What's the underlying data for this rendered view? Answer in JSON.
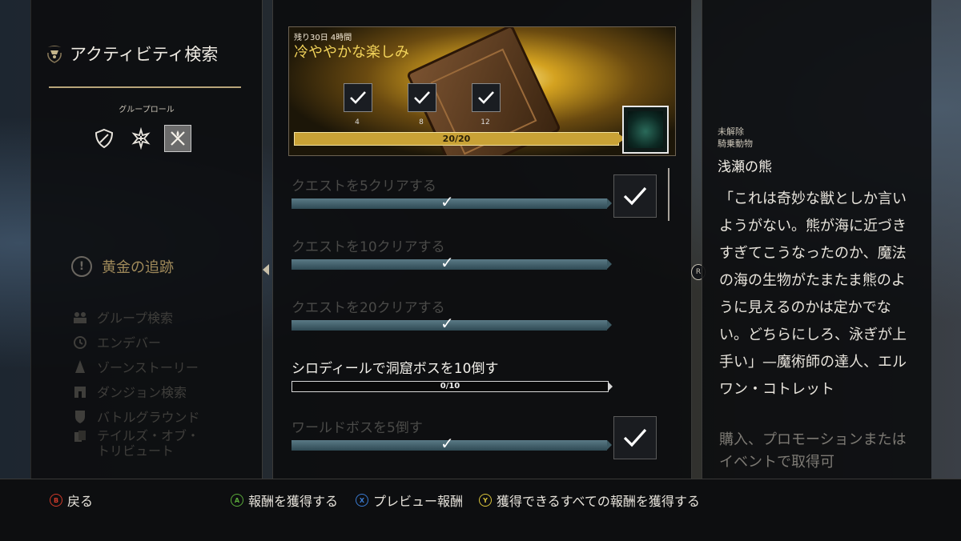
{
  "left_panel": {
    "title": "アクティビティ検索",
    "role_label": "グループロール",
    "section": "黄金の追跡",
    "nav": [
      {
        "label": "グループ検索",
        "icon": "group-icon"
      },
      {
        "label": "エンデバー",
        "icon": "endeavor-icon"
      },
      {
        "label": "ゾーンストーリー",
        "icon": "zone-story-icon"
      },
      {
        "label": "ダンジョン検索",
        "icon": "dungeon-icon"
      },
      {
        "label": "バトルグラウンド",
        "icon": "battleground-icon"
      },
      {
        "label": "テイルズ・オブ・\nトリビュート",
        "icon": "tribute-icon"
      }
    ]
  },
  "banner": {
    "timer": "残り30日 4時間",
    "title": "冷ややかな楽しみ",
    "tiers": [
      "4",
      "8",
      "12"
    ],
    "progress": "20/20",
    "progress_fraction": 1.0
  },
  "quests": [
    {
      "name": "クエストを5クリアする",
      "done": true,
      "has_icon": true
    },
    {
      "name": "クエストを10クリアする",
      "done": true,
      "has_icon": false
    },
    {
      "name": "クエストを20クリアする",
      "done": true,
      "has_icon": false
    },
    {
      "name": "シロディールで洞窟ボスを10倒す",
      "done": false,
      "progress": "0/10",
      "has_icon": false
    },
    {
      "name": "ワールドボスを5倒す",
      "done": true,
      "has_icon": true
    }
  ],
  "right_panel": {
    "status": "未解除",
    "category": "騎乗動物",
    "mount_name": "浅瀬の熊",
    "description": "「これは奇妙な獣としか言いようがない。熊が海に近づきすぎてこうなったのか、魔法の海の生物がたまたま熊のように見えるのかは定かでない。どちらにしろ、泳ぎが上手い」—魔術師の達人、エルワン・コトレット",
    "acquire": "購入、プロモーションまたはイベントで取得可"
  },
  "bottom_bar": {
    "back": {
      "button": "B",
      "label": "戻る",
      "color": "#d03a2a"
    },
    "claim": {
      "button": "A",
      "label": "報酬を獲得する",
      "color": "#5aaa3a"
    },
    "preview": {
      "button": "X",
      "label": "プレビュー報酬",
      "color": "#3a7ad0"
    },
    "claim_all": {
      "button": "Y",
      "label": "獲得できるすべての報酬を獲得する",
      "color": "#d8c23a"
    }
  },
  "scroll_button": "R"
}
